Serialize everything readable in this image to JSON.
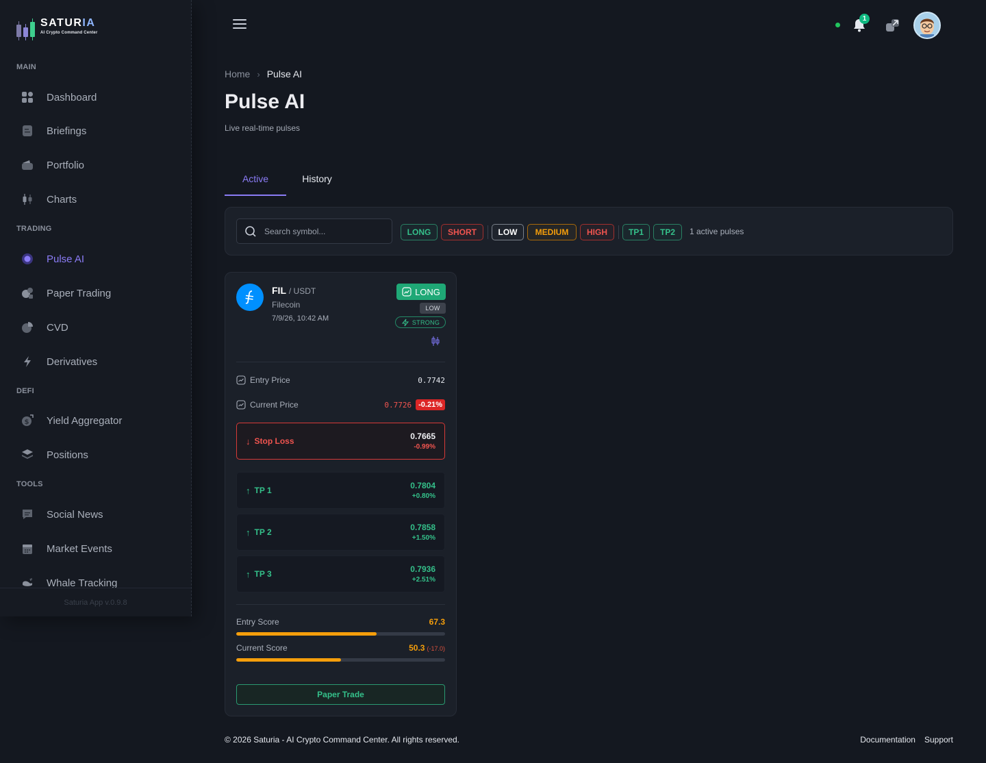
{
  "brand": {
    "name": "SATUR",
    "name_accent": "IA",
    "tagline": "AI Crypto Command Center"
  },
  "sidebar": {
    "sections": {
      "main": "MAIN",
      "trading": "TRADING",
      "defi": "DEFI",
      "tools": "TOOLS"
    },
    "items": [
      {
        "label": "Dashboard",
        "icon": "dashboard-icon"
      },
      {
        "label": "Briefings",
        "icon": "briefing-icon"
      },
      {
        "label": "Portfolio",
        "icon": "wallet-icon"
      },
      {
        "label": "Charts",
        "icon": "candlestick-icon"
      },
      {
        "label": "Pulse AI",
        "icon": "pulse-icon",
        "active": true
      },
      {
        "label": "Paper Trading",
        "icon": "paper-trading-icon"
      },
      {
        "label": "CVD",
        "icon": "pie-chart-icon"
      },
      {
        "label": "Derivatives",
        "icon": "lightning-icon"
      },
      {
        "label": "Yield Aggregator",
        "icon": "dollar-coin-icon"
      },
      {
        "label": "Positions",
        "icon": "layers-icon"
      },
      {
        "label": "Social News",
        "icon": "chat-icon"
      },
      {
        "label": "Market Events",
        "icon": "calendar-icon"
      },
      {
        "label": "Whale Tracking",
        "icon": "whale-icon"
      }
    ],
    "version": "Saturia App v.0.9.8"
  },
  "header": {
    "notification_count": "1",
    "online_color": "#22c55e"
  },
  "breadcrumb": {
    "home": "Home",
    "separator": "›",
    "current": "Pulse AI"
  },
  "page": {
    "title": "Pulse AI",
    "subtitle": "Live real-time pulses"
  },
  "tabs": [
    {
      "label": "Active",
      "active": true
    },
    {
      "label": "History",
      "active": false
    }
  ],
  "filters": {
    "search_placeholder": "Search symbol...",
    "chips": [
      "LONG",
      "SHORT",
      "LOW",
      "MEDIUM",
      "HIGH",
      "TP1",
      "TP2"
    ],
    "active_count": "1 active pulses"
  },
  "pulse": {
    "symbol": "FIL",
    "quote": "/ USDT",
    "name": "Filecoin",
    "time": "7/9/26, 10:42 AM",
    "direction": "LONG",
    "risk": "LOW",
    "strength": "STRONG",
    "entry_label": "Entry Price",
    "entry_price": "0.7742",
    "current_label": "Current Price",
    "current_price": "0.7726",
    "current_change": "-0.21%",
    "stop_loss": {
      "label": "Stop Loss",
      "price": "0.7665",
      "pct": "-0.99%"
    },
    "targets": [
      {
        "label": "TP 1",
        "price": "0.7804",
        "pct": "+0.80%"
      },
      {
        "label": "TP 2",
        "price": "0.7858",
        "pct": "+1.50%"
      },
      {
        "label": "TP 3",
        "price": "0.7936",
        "pct": "+2.51%"
      }
    ],
    "entry_score_label": "Entry Score",
    "entry_score": "67.3",
    "current_score_label": "Current Score",
    "current_score": "50.3",
    "score_delta": "(-17.0)",
    "action": "Paper Trade"
  },
  "footer": {
    "copyright": "© 2026 Saturia - AI Crypto Command Center. All rights reserved.",
    "links": [
      "Documentation",
      "Support"
    ]
  },
  "colors": {
    "accent": "#8b7cf6",
    "positive": "#34c08a",
    "negative": "#f0544f",
    "warning": "#f59e0b"
  }
}
